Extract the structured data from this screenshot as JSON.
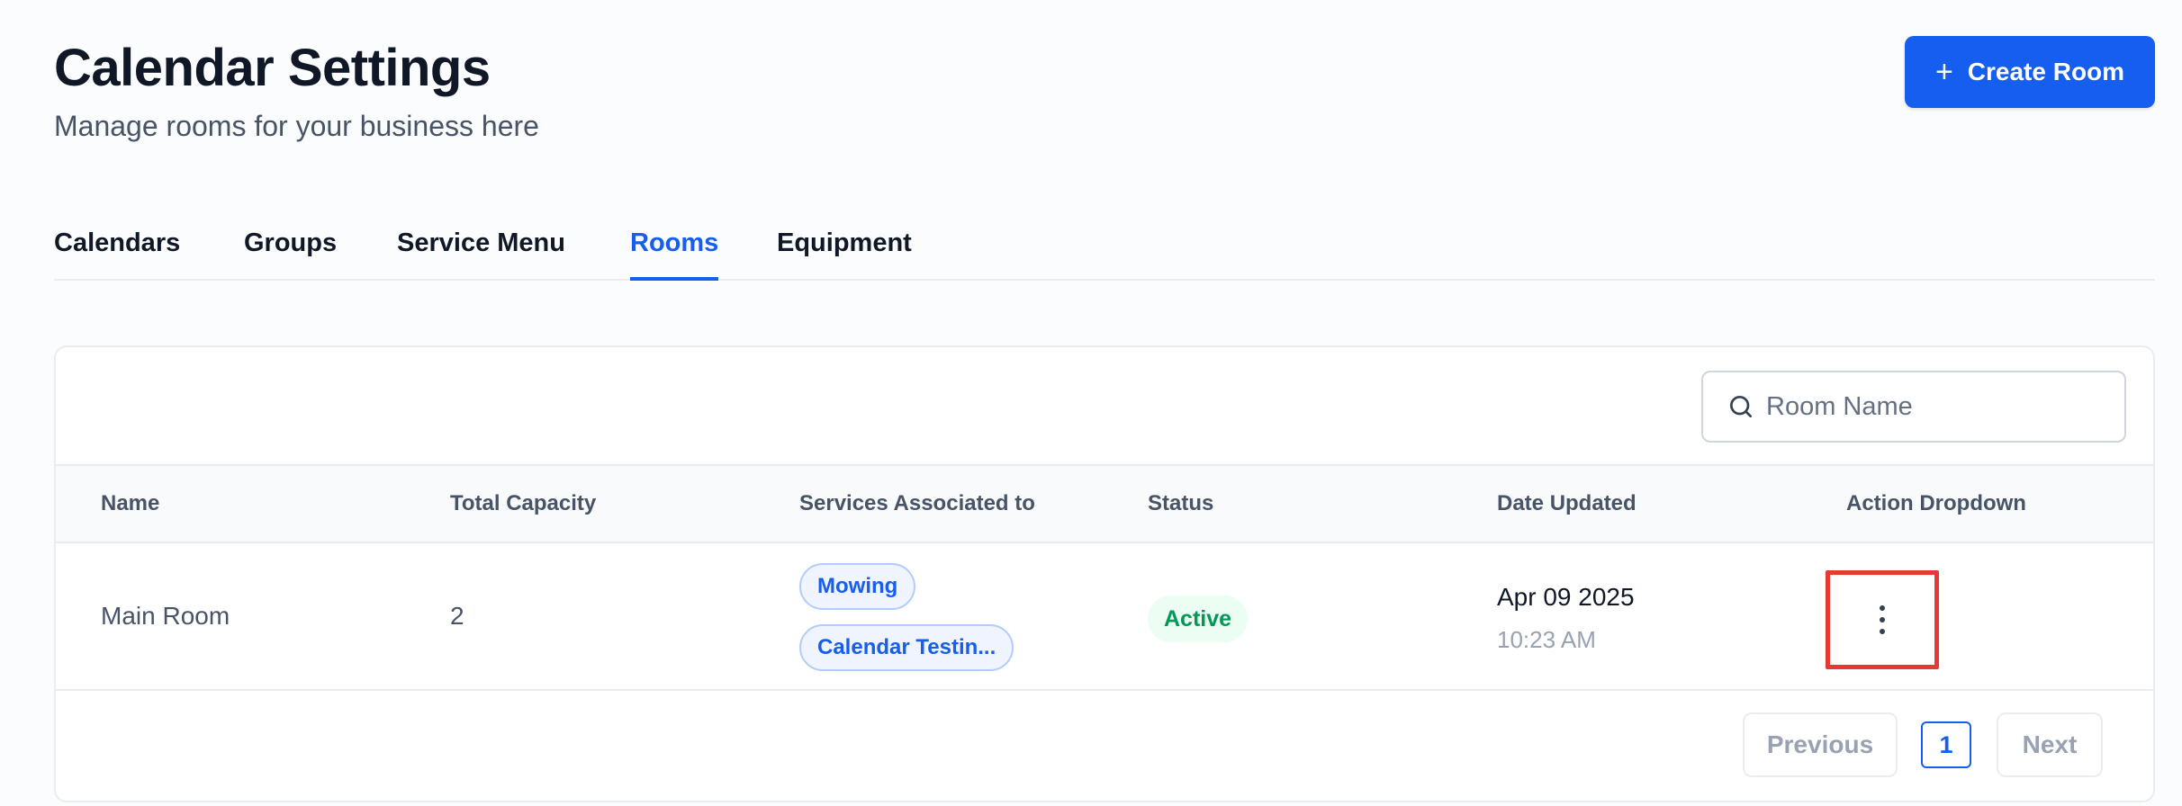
{
  "header": {
    "title": "Calendar Settings",
    "subtitle": "Manage rooms for your business here",
    "create_label": "Create Room",
    "create_icon": "plus-icon"
  },
  "tabs": [
    {
      "label": "Calendars",
      "active": false
    },
    {
      "label": "Groups",
      "active": false
    },
    {
      "label": "Service Menu",
      "active": false
    },
    {
      "label": "Rooms",
      "active": true
    },
    {
      "label": "Equipment",
      "active": false
    }
  ],
  "search": {
    "placeholder": "Room Name",
    "value": "",
    "icon": "search-icon"
  },
  "table": {
    "columns": [
      "Name",
      "Total Capacity",
      "Services Associated to",
      "Status",
      "Date Updated",
      "Action Dropdown"
    ],
    "rows": [
      {
        "name": "Main Room",
        "capacity": "2",
        "services": [
          "Mowing",
          "Calendar Testin..."
        ],
        "status": "Active",
        "date": "Apr 09 2025",
        "time": "10:23 AM",
        "action_icon": "more-vertical-icon"
      }
    ]
  },
  "pagination": {
    "previous_label": "Previous",
    "current_page": "1",
    "next_label": "Next"
  },
  "colors": {
    "accent": "#155eef",
    "status_active": "#039855",
    "highlight_box": "#e53935"
  }
}
